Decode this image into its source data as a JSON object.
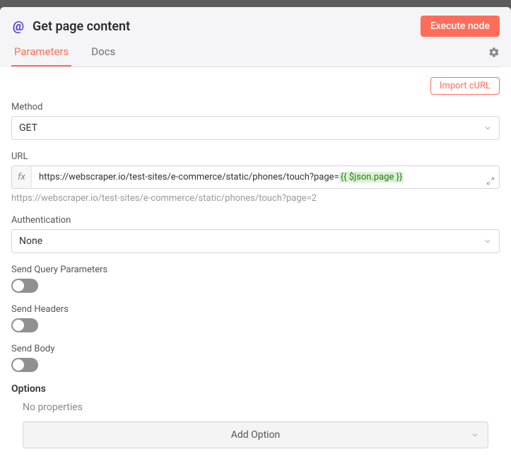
{
  "header": {
    "icon_name": "at-icon",
    "title": "Get page content",
    "execute_label": "Execute node"
  },
  "tabs": {
    "items": [
      {
        "label": "Parameters",
        "active": true
      },
      {
        "label": "Docs",
        "active": false
      }
    ]
  },
  "import_curl_label": "Import cURL",
  "method": {
    "label": "Method",
    "value": "GET"
  },
  "url": {
    "label": "URL",
    "prefix_icon": "fx",
    "value_static": "https://webscraper.io/test-sites/e-commerce/static/phones/touch?page=",
    "value_expression": "{{ $json.page }}",
    "resolved_hint": "https://webscraper.io/test-sites/e-commerce/static/phones/touch?page=2"
  },
  "authentication": {
    "label": "Authentication",
    "value": "None"
  },
  "toggles": {
    "send_query_params": {
      "label": "Send Query Parameters",
      "value": false
    },
    "send_headers": {
      "label": "Send Headers",
      "value": false
    },
    "send_body": {
      "label": "Send Body",
      "value": false
    }
  },
  "options": {
    "section_label": "Options",
    "empty_text": "No properties",
    "add_button_label": "Add Option"
  }
}
